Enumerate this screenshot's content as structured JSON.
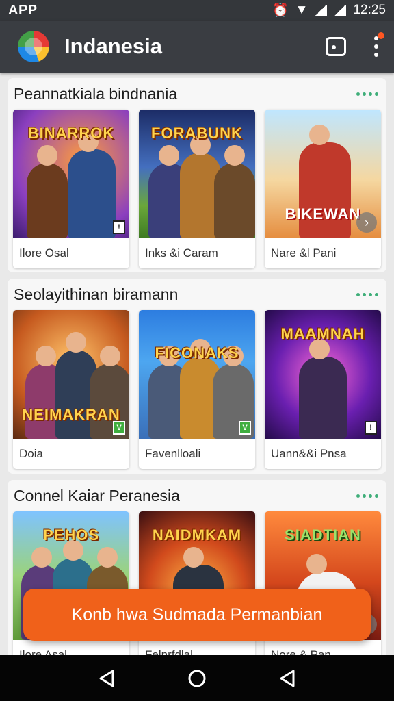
{
  "status_bar": {
    "app_label": "APP",
    "time": "12:25"
  },
  "app_bar": {
    "title": "Indanesia",
    "logo_icon": "globe-logo-icon",
    "actions": [
      "cast-icon",
      "more-vert-icon"
    ],
    "notification_color": "#ff5722"
  },
  "sections": [
    {
      "title": "Peannatkiala bindnania",
      "cards": [
        {
          "art_title": "BINARROK",
          "caption": "Ilore Osal",
          "badge": "!"
        },
        {
          "art_title": "FORABUNK",
          "caption": "Inks &i Caram",
          "badge": ""
        },
        {
          "art_title": "BIKEWAN",
          "caption": "Nare &l Pani",
          "badge": ""
        }
      ]
    },
    {
      "title": "Seolayithinan biramann",
      "cards": [
        {
          "art_title": "NEIMAKRAN",
          "caption": "Doia",
          "badge": "V"
        },
        {
          "art_title": "FICONAKS",
          "caption": "Favenlloali",
          "badge": "V"
        },
        {
          "art_title": "MAAMNAH",
          "caption": "Uann&&i Pnsa",
          "badge": "!"
        }
      ]
    },
    {
      "title": "Connel Kaiar Peranesia",
      "cards": [
        {
          "art_title": "PEHOS",
          "caption": "Ilore Asal",
          "badge": ""
        },
        {
          "art_title": "NAIDMKAM",
          "caption": "Felnrfdlal",
          "badge": ""
        },
        {
          "art_title": "SIADTIAN",
          "caption": "Nore & Pan",
          "badge": ""
        }
      ]
    }
  ],
  "cta": {
    "label": "Konb hwa Sudmada Permanbian",
    "color": "#f0611a"
  },
  "accent_green": "#3fae79"
}
